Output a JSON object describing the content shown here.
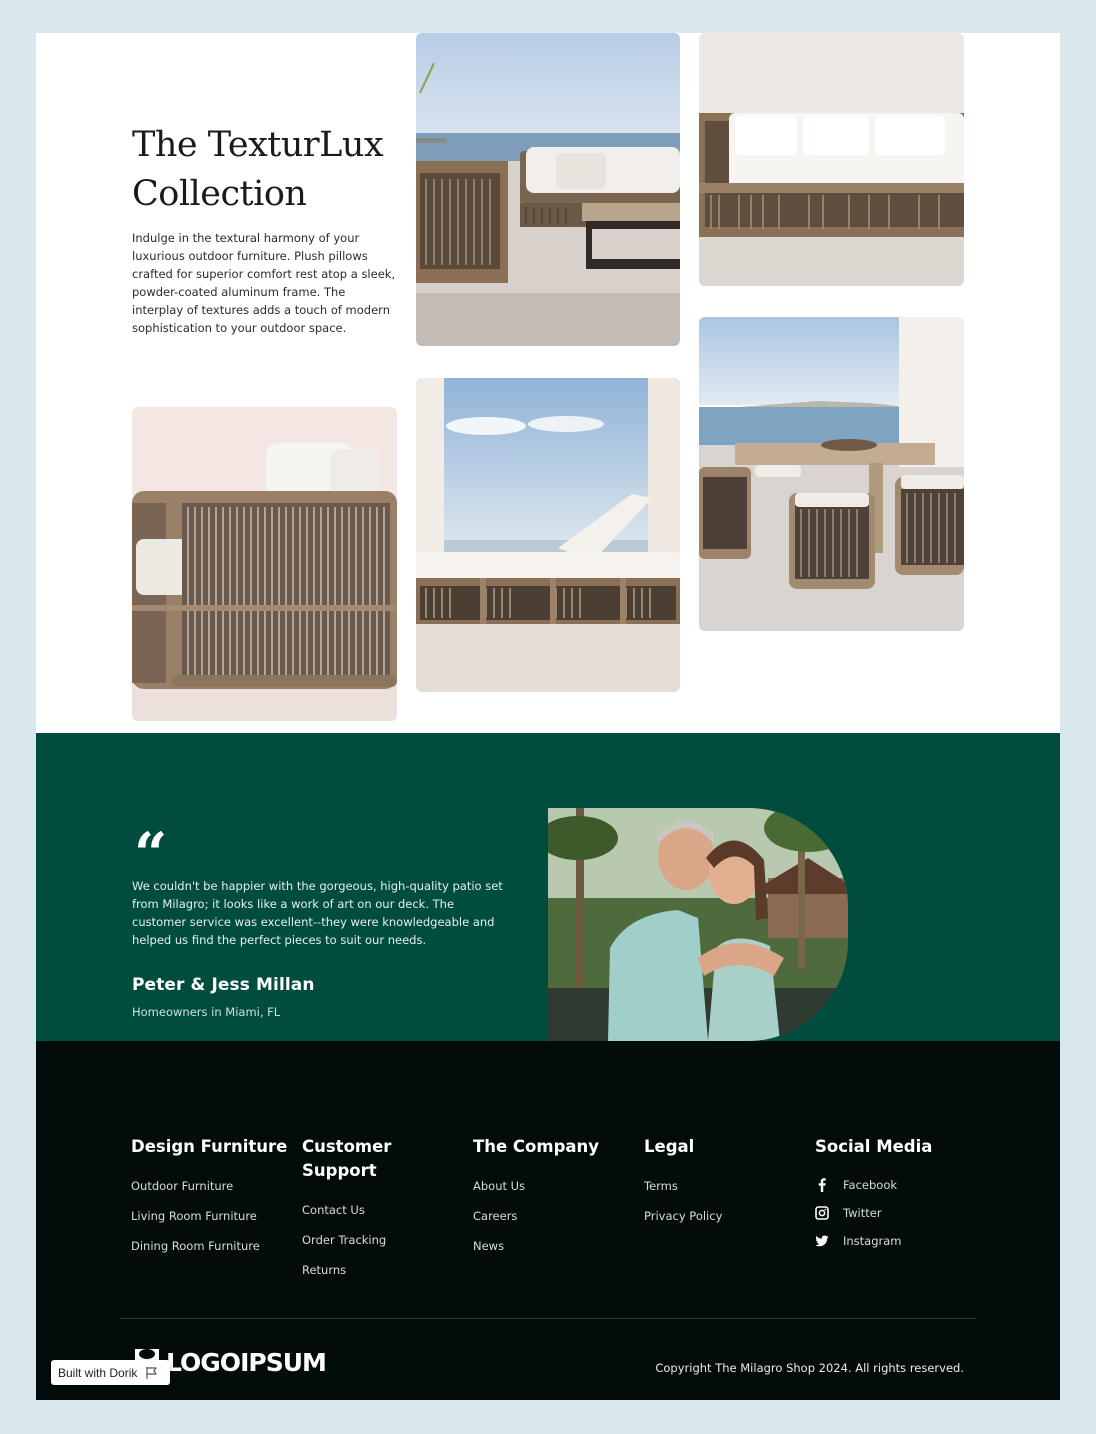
{
  "collection": {
    "title": "The TexturLux Collection",
    "description": "Indulge in the textural harmony of your luxurious outdoor furniture. Plush pillows crafted for superior comfort rest atop a sleek, powder-coated aluminum frame. The interplay of textures adds a touch of modern sophistication to your outdoor space."
  },
  "testimonial": {
    "quote_mark": "“",
    "quote": "We couldn't be happier with the gorgeous, high-quality patio set from Milagro; it looks like a work of art on our deck. The customer service was excellent--they were knowledgeable and helped us find the perfect pieces to suit our needs.",
    "author": "Peter & Jess Millan",
    "role": "Homeowners in Miami, FL"
  },
  "footer": {
    "columns": [
      {
        "heading": "Design Furniture",
        "links": [
          "Outdoor Furniture",
          "Living Room Furniture",
          "Dining Room Furniture"
        ]
      },
      {
        "heading": "Customer Support",
        "links": [
          "Contact Us",
          "Order Tracking",
          "Returns"
        ]
      },
      {
        "heading": "The Company",
        "links": [
          "About Us",
          "Careers",
          "News"
        ]
      },
      {
        "heading": "Legal",
        "links": [
          "Terms",
          "Privacy Policy"
        ]
      }
    ],
    "social": {
      "heading": "Social Media",
      "items": [
        {
          "label": "Facebook",
          "icon": "facebook-icon"
        },
        {
          "label": "Twitter",
          "icon": "instagram-glyph-icon"
        },
        {
          "label": "Instagram",
          "icon": "twitter-bird-icon"
        }
      ]
    },
    "logo_text": "LOGOIPSUM",
    "copyright": "Copyright The Milagro Shop 2024. All rights reserved."
  },
  "badge": {
    "label": "Built with Dorik"
  },
  "colors": {
    "testimonial_bg": "#004d40",
    "footer_bg": "#020c0a",
    "page_bg": "#d9e8ed"
  }
}
